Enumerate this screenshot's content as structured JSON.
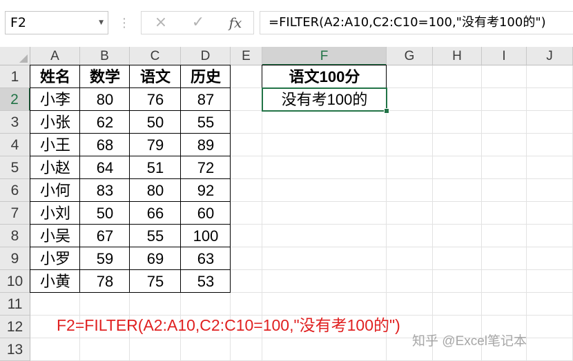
{
  "formula_bar": {
    "name_box": "F2",
    "cancel_icon": "×",
    "enter_icon": "✓",
    "function_icon": "fx",
    "formula": "=FILTER(A2:A10,C2:C10=100,\"没有考100的\")"
  },
  "columns": [
    "A",
    "B",
    "C",
    "D",
    "E",
    "F",
    "G",
    "H",
    "I",
    "J"
  ],
  "rows": [
    "1",
    "2",
    "3",
    "4",
    "5",
    "6",
    "7",
    "8",
    "9",
    "10",
    "11",
    "12",
    "13"
  ],
  "selected_cell": "F2",
  "table": {
    "headers": [
      "姓名",
      "数学",
      "语文",
      "历史"
    ],
    "rows": [
      [
        "小李",
        "80",
        "76",
        "87"
      ],
      [
        "小张",
        "62",
        "50",
        "55"
      ],
      [
        "小王",
        "68",
        "79",
        "89"
      ],
      [
        "小赵",
        "64",
        "51",
        "72"
      ],
      [
        "小何",
        "83",
        "80",
        "92"
      ],
      [
        "小刘",
        "50",
        "66",
        "60"
      ],
      [
        "小吴",
        "67",
        "55",
        "100"
      ],
      [
        "小罗",
        "59",
        "69",
        "63"
      ],
      [
        "小黄",
        "78",
        "75",
        "53"
      ]
    ]
  },
  "result": {
    "header": "语文100分",
    "value": "没有考100的"
  },
  "note": "F2=FILTER(A2:A10,C2:C10=100,\"没有考100的\")",
  "watermark": "知乎 @Excel笔记本",
  "colors": {
    "accent": "#217346",
    "note": "#e02020"
  }
}
